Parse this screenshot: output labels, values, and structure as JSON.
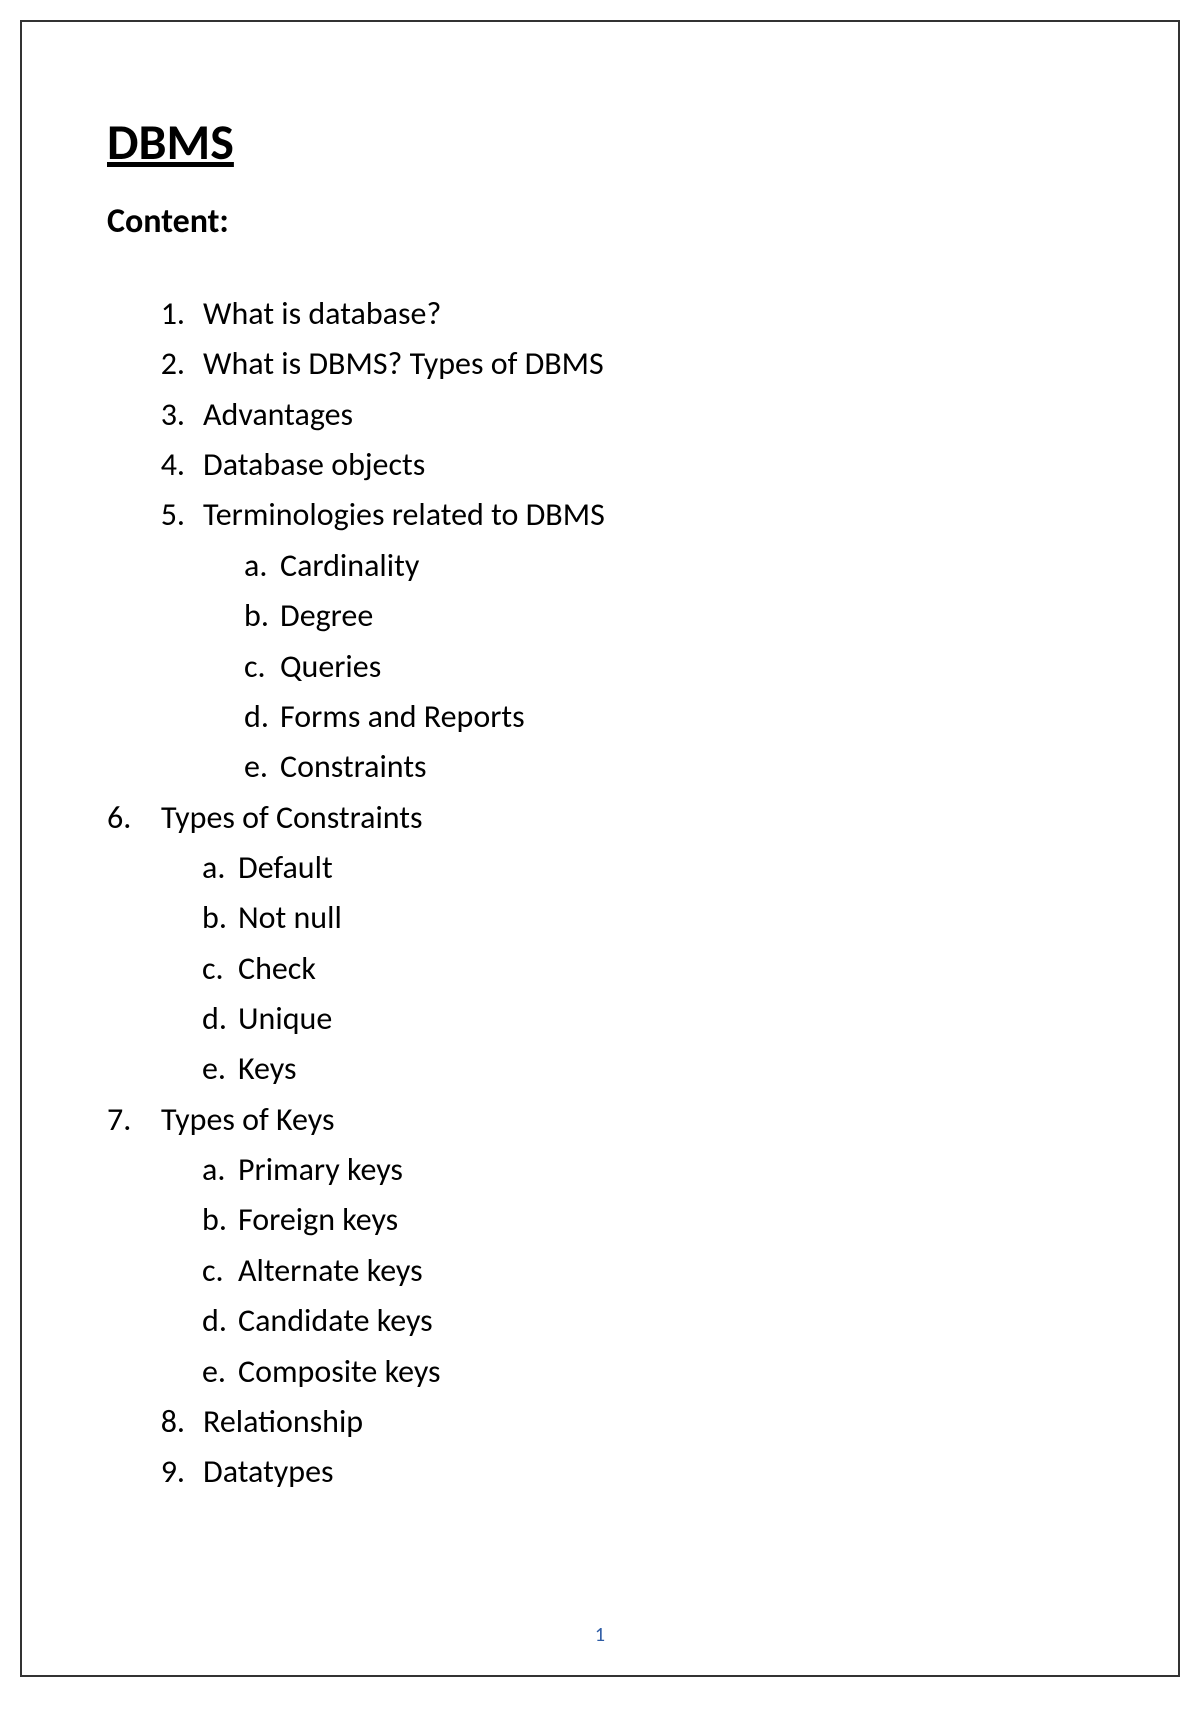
{
  "title": "DBMS",
  "subtitle": "Content:",
  "items": {
    "1": {
      "num": "1.",
      "text": "What is database?"
    },
    "2": {
      "num": "2.",
      "text": "What is DBMS? Types of DBMS"
    },
    "3": {
      "num": "3.",
      "text": "Advantages"
    },
    "4": {
      "num": "4.",
      "text": "Database objects"
    },
    "5": {
      "num": "5.",
      "text": "Terminologies related to DBMS",
      "sub": {
        "a": {
          "letter": "a.",
          "text": "Cardinality"
        },
        "b": {
          "letter": "b.",
          "text": "Degree"
        },
        "c": {
          "letter": "c.",
          "text": "Queries"
        },
        "d": {
          "letter": "d.",
          "text": "Forms and Reports"
        },
        "e": {
          "letter": "e.",
          "text": "Constraints"
        }
      }
    },
    "6": {
      "num": "6.",
      "text": "Types of Constraints",
      "sub": {
        "a": {
          "letter": "a.",
          "text": "Default"
        },
        "b": {
          "letter": "b.",
          "text": "Not null"
        },
        "c": {
          "letter": "c.",
          "text": "Check"
        },
        "d": {
          "letter": "d.",
          "text": "Unique"
        },
        "e": {
          "letter": "e.",
          "text": "Keys"
        }
      }
    },
    "7": {
      "num": "7.",
      "text": "Types of Keys",
      "sub": {
        "a": {
          "letter": "a.",
          "text": "Primary keys"
        },
        "b": {
          "letter": "b.",
          "text": "Foreign keys"
        },
        "c": {
          "letter": "c.",
          "text": "Alternate keys"
        },
        "d": {
          "letter": "d.",
          "text": "Candidate keys"
        },
        "e": {
          "letter": "e.",
          "text": "Composite keys"
        }
      }
    },
    "8": {
      "num": "8.",
      "text": "Relationship"
    },
    "9": {
      "num": "9.",
      "text": "Datatypes"
    }
  },
  "pageNumber": "1"
}
